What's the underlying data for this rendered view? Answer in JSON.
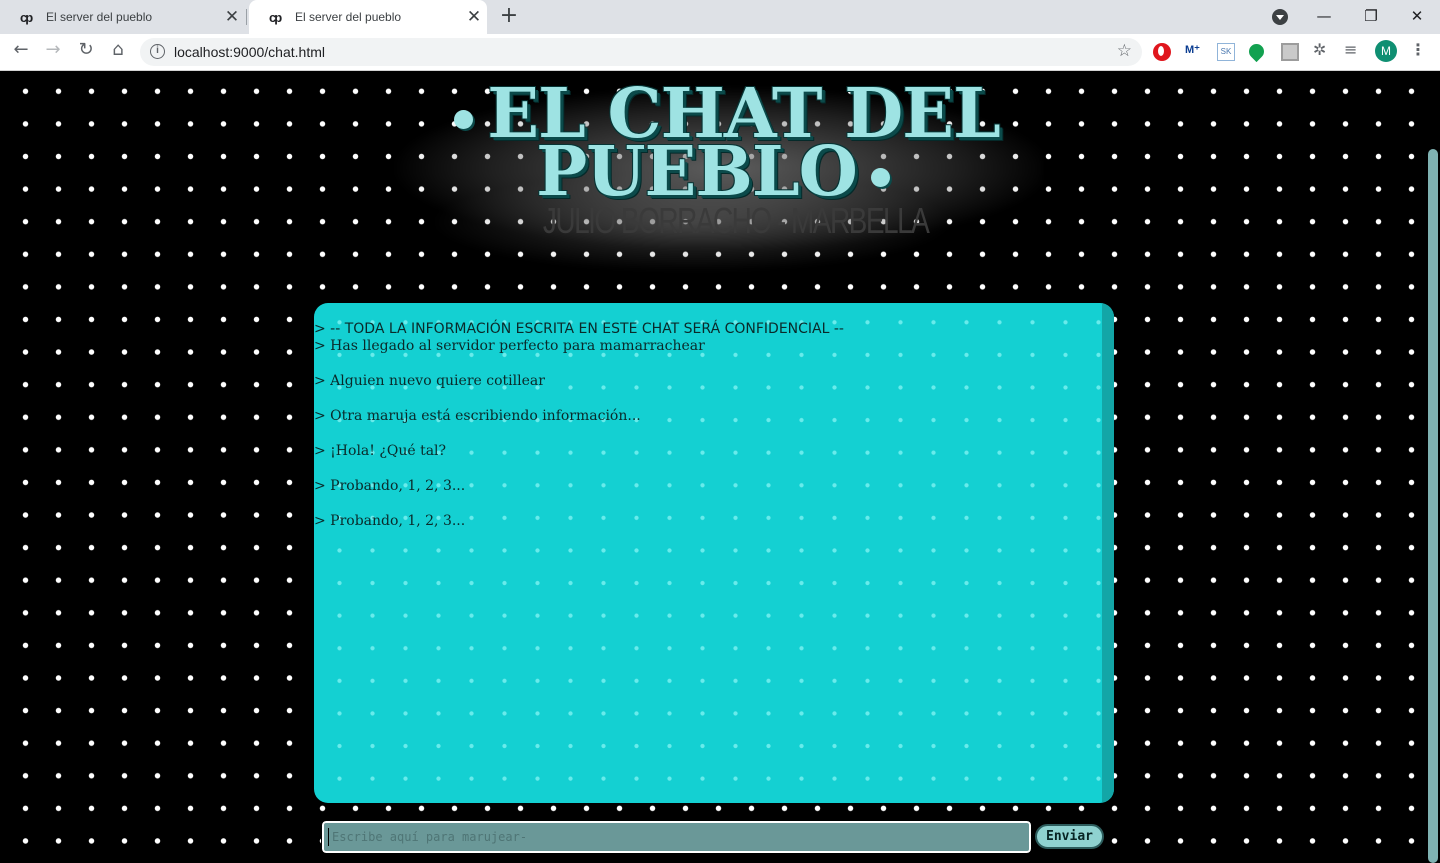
{
  "browser": {
    "tabs": [
      {
        "favicon": "cp",
        "title": "El server del pueblo",
        "close": "✕",
        "active": false
      },
      {
        "favicon": "cp",
        "title": "El server del pueblo",
        "close": "✕",
        "active": true
      }
    ],
    "new_tab": "+",
    "window_controls": {
      "minimize": "—",
      "restore": "❐",
      "close": "✕"
    },
    "nav": {
      "back": "←",
      "forward": "→",
      "reload": "↻",
      "home": "⌂"
    },
    "address_info": "i",
    "url": "localhost:9000/chat.html",
    "bookmark": "☆",
    "extensions": {
      "sk": "SK",
      "puzzle": "✲",
      "list": "≡"
    },
    "avatar_letter": "M",
    "menu": "⋮"
  },
  "header": {
    "logo_line1": "EL CHAT DEL",
    "logo_line2": "PUEBLO",
    "subtitle": "JULIO BORRACHO - MARBELLA",
    "logo_color": "#9ee3e3"
  },
  "chat": {
    "messages": [
      "> -- TODA LA INFORMACIÓN ESCRITA EN ESTE CHAT SERÁ CONFIDENCIAL --",
      "> Has llegado al servidor perfecto para mamarrachear",
      "> Alguien nuevo quiere cotillear",
      "> Otra maruja está escribiendo información...",
      "> ¡Hola! ¿Qué tal?",
      "> Probando, 1, 2, 3...",
      "> Probando, 1, 2, 3..."
    ],
    "box_color": "#14d0d2",
    "input_placeholder": "Escribe aquí para marujear-",
    "input_value": "",
    "send_label": "Enviar"
  }
}
